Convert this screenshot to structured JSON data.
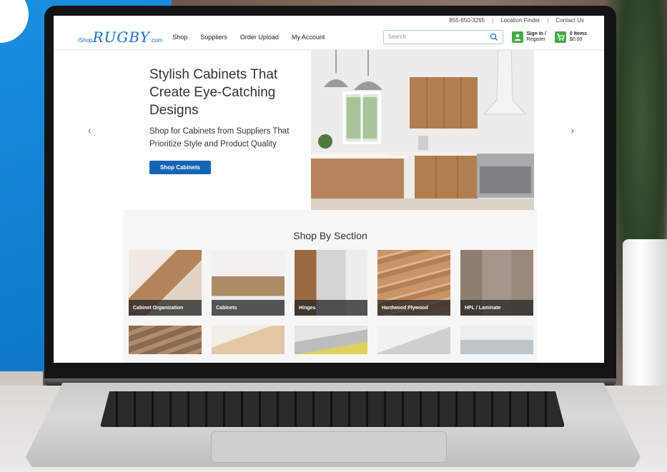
{
  "site": {
    "logo_prefix": "iShop",
    "logo_main": "RUGBY",
    "logo_suffix": ".com"
  },
  "topbar": {
    "phone": "855-650-3265",
    "location_finder": "Location Finder",
    "contact": "Contact Us",
    "separator": "|"
  },
  "nav": {
    "items": [
      "Shop",
      "Suppliers",
      "Order Upload",
      "My Account"
    ]
  },
  "search": {
    "placeholder": "Search"
  },
  "account": {
    "line1": "Sign In /",
    "line2": "Register"
  },
  "cart": {
    "count_label": "0 Items",
    "total": "$0.00"
  },
  "hero": {
    "title": "Stylish Cabinets That Create Eye-Catching Designs",
    "subtitle": "Shop for Cabinets from Suppliers That Prioritize Style and Product Quality",
    "button": "Shop Cabinets",
    "prev": "‹",
    "next": "›"
  },
  "section": {
    "title": "Shop By Section",
    "tiles": [
      {
        "label": "Cabinet Organization"
      },
      {
        "label": "Cabinets"
      },
      {
        "label": "Hinges"
      },
      {
        "label": "Hardwood Plywood"
      },
      {
        "label": "HPL / Laminate"
      }
    ]
  },
  "colors": {
    "brand_blue": "#1b6fc2",
    "button_blue": "#1565b4",
    "account_green": "#49a84a"
  }
}
